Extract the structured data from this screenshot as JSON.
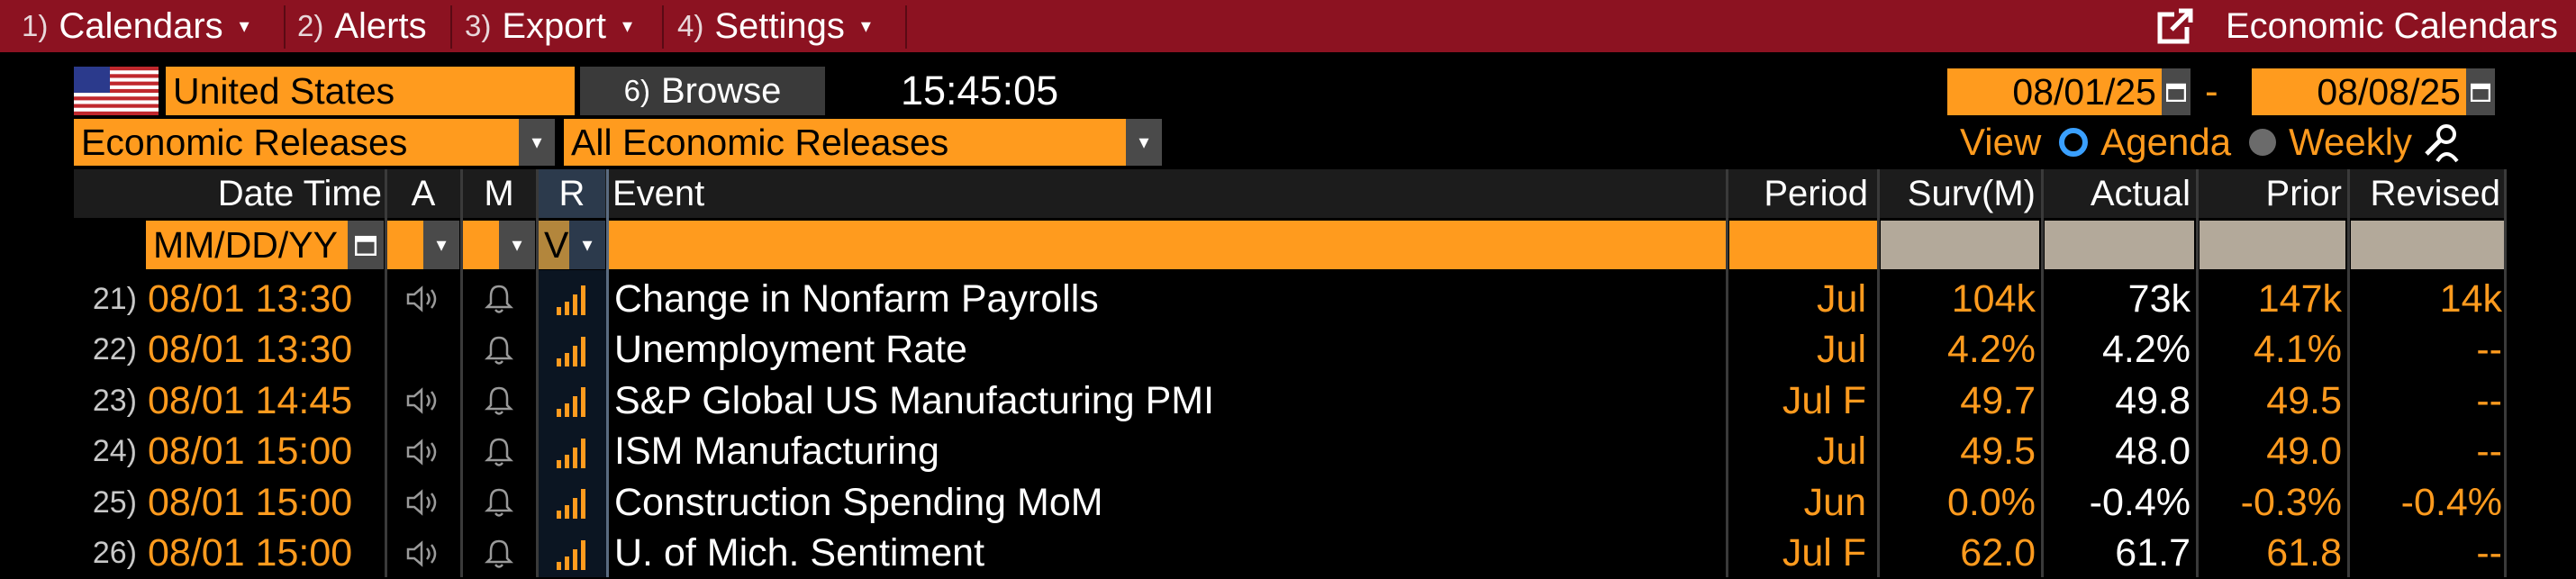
{
  "menu": [
    {
      "num": "1)",
      "label": "Calendars",
      "caret": "▾"
    },
    {
      "num": "2)",
      "label": "Alerts",
      "caret": ""
    },
    {
      "num": "3)",
      "label": "Export",
      "caret": "▾"
    },
    {
      "num": "4)",
      "label": "Settings",
      "caret": "▾"
    }
  ],
  "title": "Economic Calendars",
  "country": "United States",
  "browse": {
    "num": "6)",
    "label": "Browse"
  },
  "clock": "15:45:05",
  "date_from": "08/01/25",
  "date_sep": "-",
  "date_to": "08/08/25",
  "release_type": "Economic Releases",
  "release_filter": "All Economic Releases",
  "view": {
    "label": "View",
    "agenda": "Agenda",
    "weekly": "Weekly"
  },
  "columns": {
    "datetime": "Date Time",
    "a": "A",
    "m": "M",
    "r": "R",
    "event": "Event",
    "period": "Period",
    "surv": "Surv(M)",
    "actual": "Actual",
    "prior": "Prior",
    "revised": "Revised"
  },
  "filters": {
    "date_placeholder": "MM/DD/YY",
    "r_value": "V"
  },
  "rows": [
    {
      "num": "21)",
      "datetime": "08/01 13:30",
      "a_icon": true,
      "event": "Change in Nonfarm Payrolls",
      "period": "Jul",
      "surv": "104k",
      "actual": "73k",
      "prior": "147k",
      "revised": "14k"
    },
    {
      "num": "22)",
      "datetime": "08/01 13:30",
      "a_icon": false,
      "event": "Unemployment Rate",
      "period": "Jul",
      "surv": "4.2%",
      "actual": "4.2%",
      "prior": "4.1%",
      "revised": "--"
    },
    {
      "num": "23)",
      "datetime": "08/01 14:45",
      "a_icon": true,
      "event": "S&P Global US Manufacturing PMI",
      "period": "Jul F",
      "surv": "49.7",
      "actual": "49.8",
      "prior": "49.5",
      "revised": "--"
    },
    {
      "num": "24)",
      "datetime": "08/01 15:00",
      "a_icon": true,
      "event": "ISM Manufacturing",
      "period": "Jul",
      "surv": "49.5",
      "actual": "48.0",
      "prior": "49.0",
      "revised": "--"
    },
    {
      "num": "25)",
      "datetime": "08/01 15:00",
      "a_icon": true,
      "event": "Construction Spending MoM",
      "period": "Jun",
      "surv": "0.0%",
      "actual": "-0.4%",
      "prior": "-0.3%",
      "revised": "-0.4%"
    },
    {
      "num": "26)",
      "datetime": "08/01 15:00",
      "a_icon": true,
      "event": "U. of Mich. Sentiment",
      "period": "Jul F",
      "surv": "62.0",
      "actual": "61.7",
      "prior": "61.8",
      "revised": "--"
    }
  ],
  "colors": {
    "menubar": "#8c1221",
    "accent": "#ff9b1e",
    "header_bg": "#1c1c1c",
    "filter_gray": "#b3a99a"
  }
}
